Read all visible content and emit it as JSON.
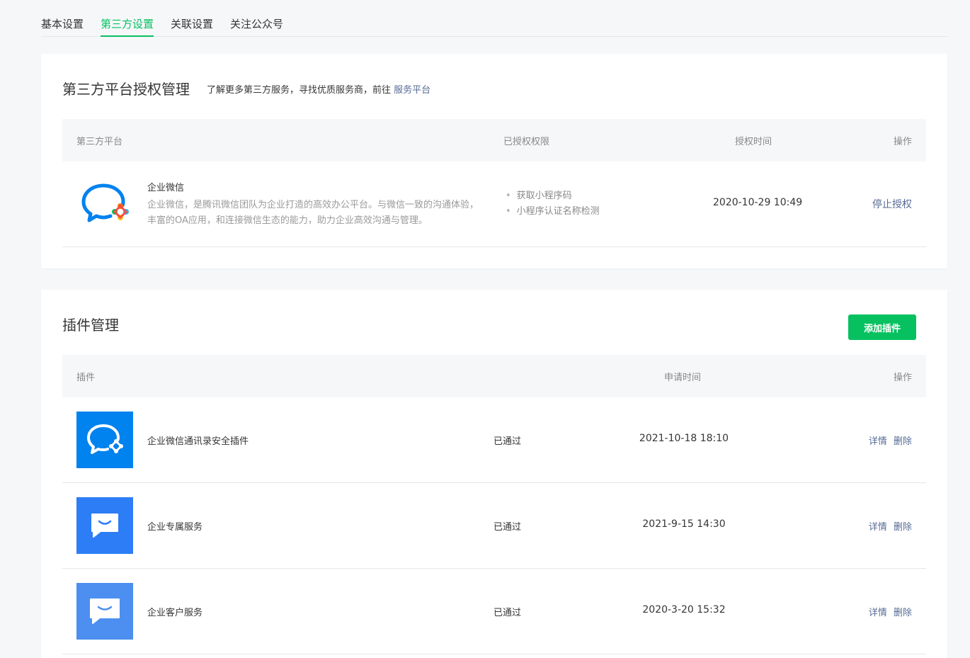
{
  "tabs": [
    {
      "label": "基本设置",
      "active": false
    },
    {
      "label": "第三方设置",
      "active": true
    },
    {
      "label": "关联设置",
      "active": false
    },
    {
      "label": "关注公众号",
      "active": false
    }
  ],
  "auth": {
    "title": "第三方平台授权管理",
    "desc": "了解更多第三方服务，寻找优质服务商，前往",
    "desc_link": "服务平台",
    "columns": {
      "platform": "第三方平台",
      "permissions": "已授权权限",
      "time": "授权时间",
      "op": "操作"
    },
    "rows": [
      {
        "name": "企业微信",
        "description": "企业微信，是腾讯微信团队为企业打造的高效办公平台。与微信一致的沟通体验，丰富的OA应用，和连接微信生态的能力，助力企业高效沟通与管理。",
        "permissions": [
          "获取小程序码",
          "小程序认证名称检测"
        ],
        "time": "2020-10-29 10:49",
        "op": "停止授权"
      }
    ]
  },
  "plugins": {
    "title": "插件管理",
    "add_label": "添加插件",
    "columns": {
      "plugin": "插件",
      "time": "申请时间",
      "op": "操作"
    },
    "rows": [
      {
        "name": "企业微信通讯录安全插件",
        "status": "已通过",
        "time": "2021-10-18 18:10",
        "detail": "详情",
        "delete": "删除",
        "icon": "wecom-chat-icon",
        "color": "#0082ef"
      },
      {
        "name": "企业专属服务",
        "status": "已通过",
        "time": "2021-9-15 14:30",
        "detail": "详情",
        "delete": "删除",
        "icon": "smile-chat-icon",
        "color": "#2d7df6"
      },
      {
        "name": "企业客户服务",
        "status": "已通过",
        "time": "2020-3-20 15:32",
        "detail": "详情",
        "delete": "删除",
        "icon": "smile-chat-icon",
        "color": "#4c8ff0"
      }
    ]
  },
  "colors": {
    "accent": "#07c160",
    "link": "#576b95"
  }
}
